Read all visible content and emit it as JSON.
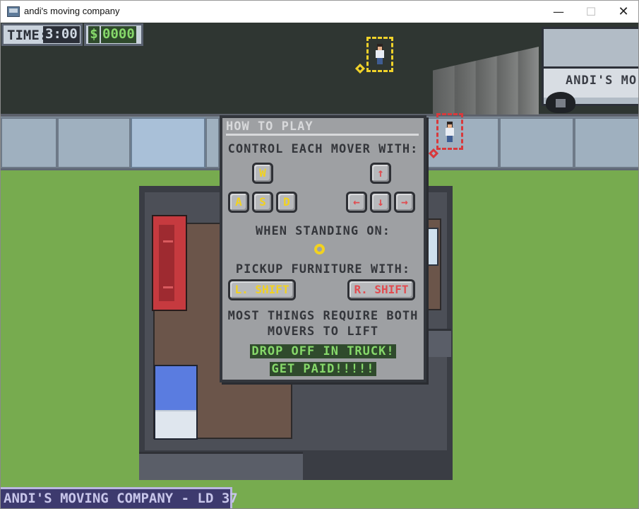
{
  "window": {
    "title": "andi's moving company",
    "minimize_glyph": "—",
    "maximize_glyph": "☐",
    "close_glyph": "✕"
  },
  "hud": {
    "time_label": "TIME:",
    "time_value": "3:00",
    "money_sign": "$",
    "money_value": "0000"
  },
  "truck": {
    "label": "ANDI'S MO"
  },
  "footer": {
    "text": "ANDI'S MOVING COMPANY - LD 37"
  },
  "help": {
    "title": "HOW TO PLAY",
    "control_line": "CONTROL EACH MOVER WITH:",
    "left_keys": {
      "up": "W",
      "left": "A",
      "down": "S",
      "right": "D"
    },
    "right_keys": {
      "up": "↑",
      "left": "←",
      "down": "↓",
      "right": "→"
    },
    "standing_line": "WHEN STANDING ON:",
    "pickup_line": "PICKUP FURNITURE WITH:",
    "left_shift": "L. SHIFT",
    "right_shift": "R. SHIFT",
    "most_line1": "MOST THINGS REQUIRE BOTH",
    "most_line2": "MOVERS TO LIFT",
    "drop_line": "DROP OFF IN TRUCK!",
    "paid_line": "GET PAID!!!!!"
  },
  "colors": {
    "player1": "#f0d22a",
    "player2": "#d8393c",
    "money_text": "#86d86a",
    "grass": "#77ab4f"
  },
  "icons": {
    "app": "moving-truck-icon",
    "target": "target-ring-icon"
  }
}
